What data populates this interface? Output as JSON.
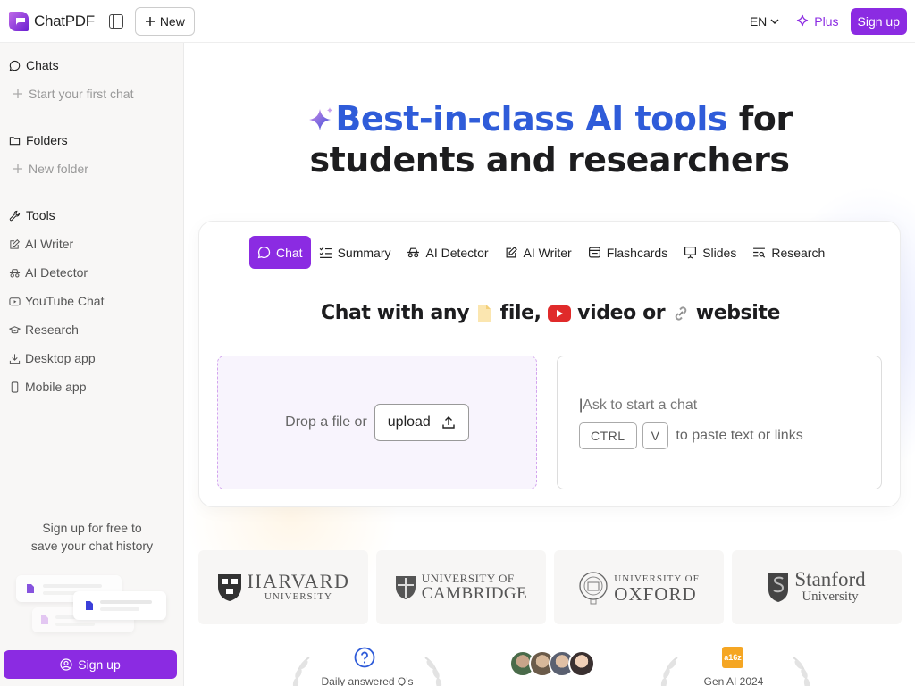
{
  "app": {
    "name": "ChatPDF"
  },
  "topbar": {
    "new_label": "New",
    "language": "EN",
    "plus_label": "Plus",
    "signup_label": "Sign up"
  },
  "sidebar": {
    "chats_heading": "Chats",
    "start_chat": "Start your first chat",
    "folders_heading": "Folders",
    "new_folder": "New folder",
    "tools_heading": "Tools",
    "tools": [
      {
        "label": "AI Writer",
        "icon": "pencil-square-icon"
      },
      {
        "label": "AI Detector",
        "icon": "detective-icon"
      },
      {
        "label": "YouTube Chat",
        "icon": "youtube-icon"
      },
      {
        "label": "Research",
        "icon": "graduation-cap-icon"
      },
      {
        "label": "Desktop app",
        "icon": "download-icon"
      },
      {
        "label": "Mobile app",
        "icon": "phone-icon"
      }
    ],
    "promo_line1": "Sign up for free to",
    "promo_line2": "save your chat history",
    "signup_label": "Sign up"
  },
  "hero": {
    "highlight": "Best-in-class AI tools",
    "rest1": " for",
    "line2": "students and researchers"
  },
  "tabs": [
    {
      "label": "Chat",
      "icon": "chat-bubble-icon",
      "active": true
    },
    {
      "label": "Summary",
      "icon": "checklist-icon",
      "active": false
    },
    {
      "label": "AI Detector",
      "icon": "detective-icon",
      "active": false
    },
    {
      "label": "AI Writer",
      "icon": "pencil-square-icon",
      "active": false
    },
    {
      "label": "Flashcards",
      "icon": "flashcards-icon",
      "active": false
    },
    {
      "label": "Slides",
      "icon": "presentation-icon",
      "active": false
    },
    {
      "label": "Research",
      "icon": "search-list-icon",
      "active": false
    }
  ],
  "panel": {
    "title_part1": "Chat with any",
    "title_part2": "file,",
    "title_part3": "video or",
    "title_part4": "website",
    "drop_text": "Drop a file or",
    "upload_label": "upload",
    "ask_placeholder": "Ask to start a chat",
    "key_ctrl": "CTRL",
    "key_v": "V",
    "paste_text": "to paste text or links"
  },
  "universities": {
    "harvard_1": "HARVARD",
    "harvard_2": "UNIVERSITY",
    "cambridge_1": "UNIVERSITY OF",
    "cambridge_2": "CAMBRIDGE",
    "oxford_1": "UNIVERSITY OF",
    "oxford_2": "OXFORD",
    "stanford_1": "Stanford",
    "stanford_2": "University"
  },
  "stats": {
    "answered_label": "Daily answered Q's",
    "genai_badge": "a16z",
    "genai_label": "Gen AI 2024"
  },
  "colors": {
    "brand": "#8b2be2",
    "highlight": "#2f5cd9"
  }
}
